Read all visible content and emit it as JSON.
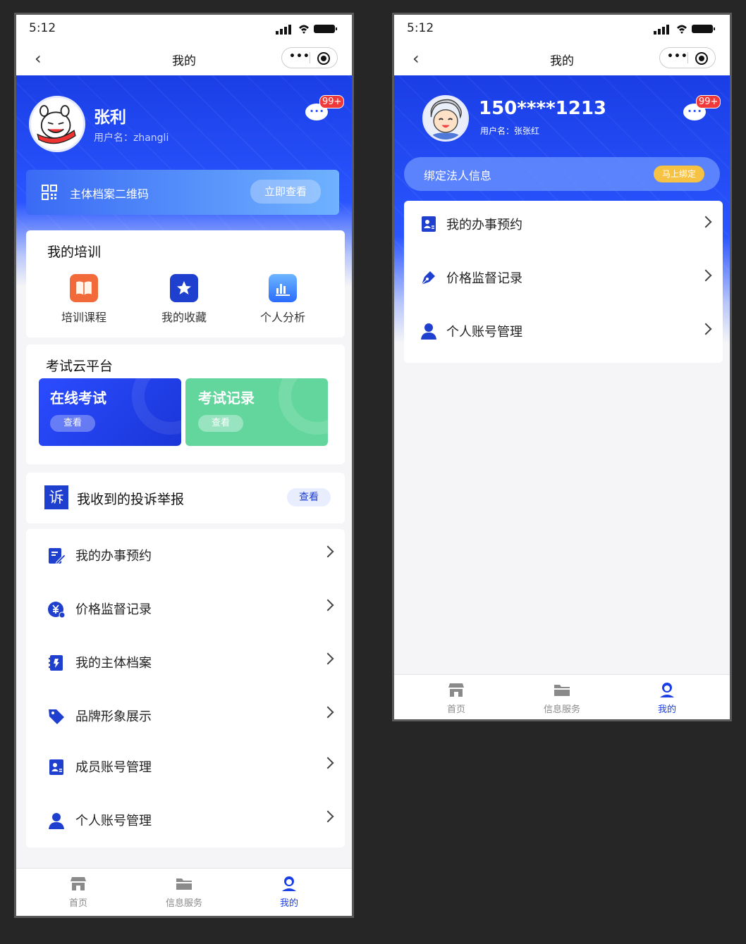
{
  "status_bar": {
    "time": "5:12"
  },
  "nav": {
    "title": "我的"
  },
  "unread_badge": "99+",
  "screen_a": {
    "user": {
      "name": "张利",
      "username": "用户名：zhangli"
    },
    "qr_banner": {
      "label": "主体档案二维码",
      "button": "立即查看"
    },
    "training": {
      "title": "我的培训",
      "items": [
        {
          "label": "培训课程",
          "icon": "book-icon",
          "color": "#f26a3a"
        },
        {
          "label": "我的收藏",
          "icon": "star-icon",
          "color": "#1f3fcf"
        },
        {
          "label": "个人分析",
          "icon": "bar-chart-icon",
          "color": "#3a86ff"
        }
      ]
    },
    "exam": {
      "title": "考试云平台",
      "online": {
        "label": "在线考试",
        "button": "查看"
      },
      "records": {
        "label": "考试记录",
        "button": "查看"
      }
    },
    "complaint": {
      "icon_text": "诉",
      "label": "我收到的投诉举报",
      "button": "查看"
    },
    "menu": [
      {
        "label": "我的办事预约",
        "icon": "edit-doc-icon"
      },
      {
        "label": "价格监督记录",
        "icon": "price-yen-icon"
      },
      {
        "label": "我的主体档案",
        "icon": "archive-icon"
      },
      {
        "label": "品牌形象展示",
        "icon": "tag-icon"
      },
      {
        "label": "成员账号管理",
        "icon": "id-card-icon"
      },
      {
        "label": "个人账号管理",
        "icon": "person-icon"
      }
    ]
  },
  "screen_b": {
    "user": {
      "name": "150****1213",
      "username": "用户名：张张红"
    },
    "bind_banner": {
      "label": "绑定法人信息",
      "button": "马上绑定"
    },
    "menu": [
      {
        "label": "我的办事预约",
        "icon": "id-card-icon"
      },
      {
        "label": "价格监督记录",
        "icon": "pen-nib-icon"
      },
      {
        "label": "个人账号管理",
        "icon": "person-icon"
      }
    ]
  },
  "tabbar": [
    {
      "label": "首页",
      "icon": "shop-icon"
    },
    {
      "label": "信息服务",
      "icon": "folder-icon"
    },
    {
      "label": "我的",
      "icon": "user-icon",
      "active": true
    }
  ],
  "colors": {
    "primary": "#1a3ee6",
    "green": "#5dd49a",
    "badge": "#f03a3a"
  }
}
